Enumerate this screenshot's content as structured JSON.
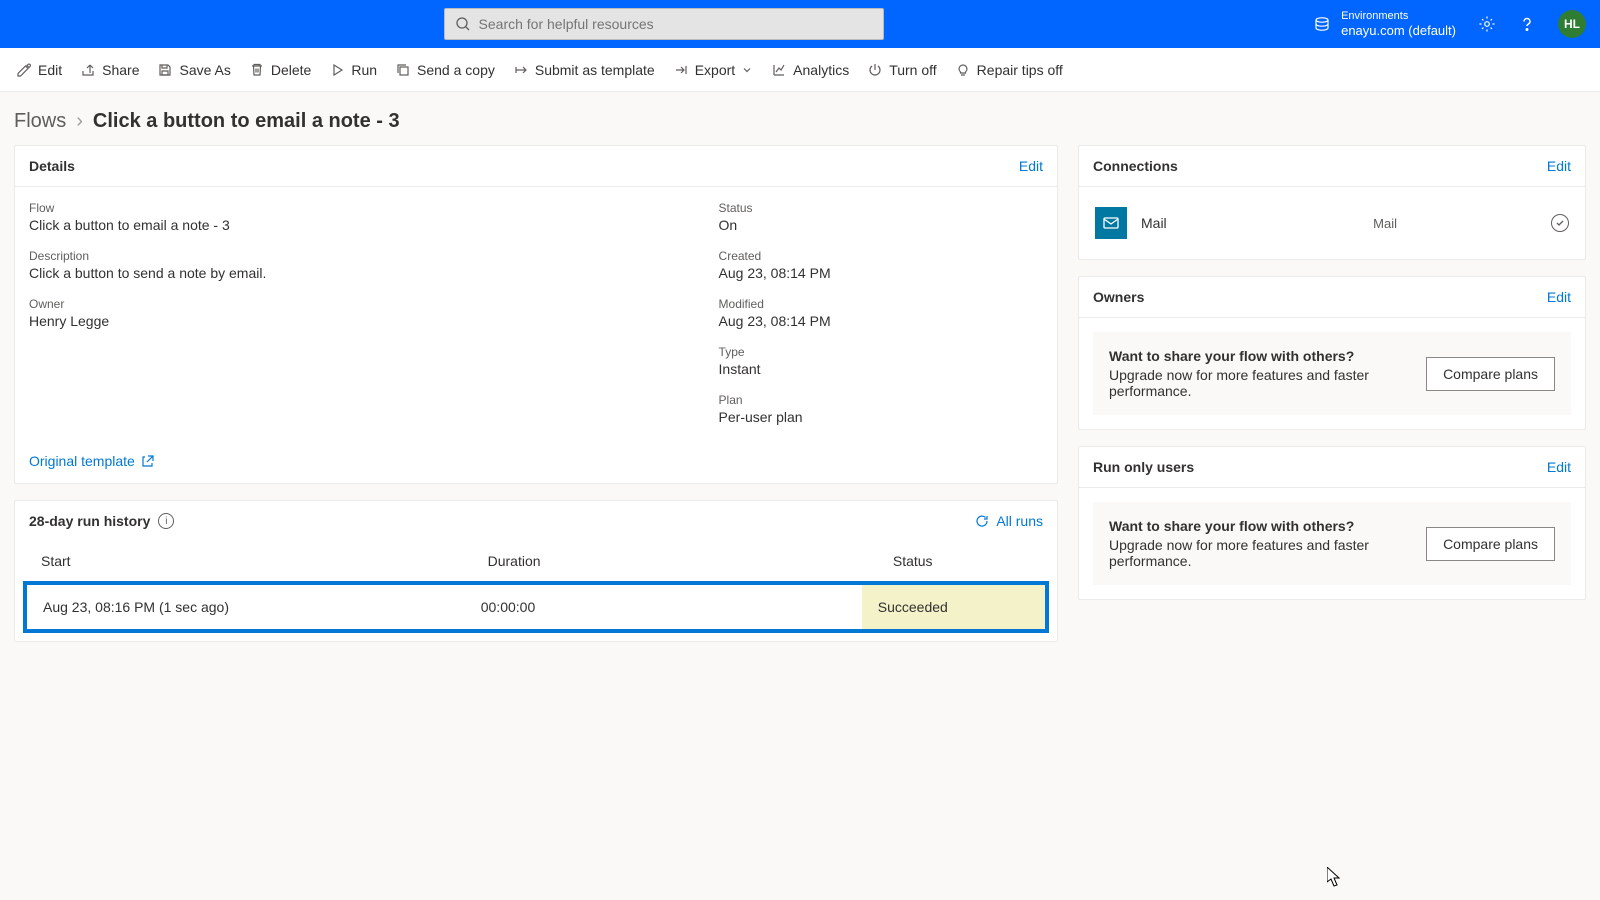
{
  "header": {
    "search_placeholder": "Search for helpful resources",
    "env_label": "Environments",
    "env_value": "enayu.com (default)",
    "avatar": "HL"
  },
  "toolbar": {
    "edit": "Edit",
    "share": "Share",
    "save_as": "Save As",
    "delete": "Delete",
    "run": "Run",
    "send_copy": "Send a copy",
    "submit_template": "Submit as template",
    "export": "Export",
    "analytics": "Analytics",
    "turn_off": "Turn off",
    "repair_tips": "Repair tips off"
  },
  "breadcrumb": {
    "root": "Flows",
    "current": "Click a button to email a note - 3"
  },
  "cards": {
    "details_title": "Details",
    "connections_title": "Connections",
    "owners_title": "Owners",
    "run_only_title": "Run only users",
    "edit": "Edit"
  },
  "details": {
    "flow_label": "Flow",
    "flow_value": "Click a button to email a note - 3",
    "desc_label": "Description",
    "desc_value": "Click a button to send a note by email.",
    "owner_label": "Owner",
    "owner_value": "Henry Legge",
    "status_label": "Status",
    "status_value": "On",
    "created_label": "Created",
    "created_value": "Aug 23, 08:14 PM",
    "modified_label": "Modified",
    "modified_value": "Aug 23, 08:14 PM",
    "type_label": "Type",
    "type_value": "Instant",
    "plan_label": "Plan",
    "plan_value": "Per-user plan",
    "original_template": "Original template"
  },
  "history": {
    "title": "28-day run history",
    "all_runs": "All runs",
    "col_start": "Start",
    "col_duration": "Duration",
    "col_status": "Status",
    "row_start": "Aug 23, 08:16 PM (1 sec ago)",
    "row_duration": "00:00:00",
    "row_status": "Succeeded"
  },
  "connections": {
    "name": "Mail",
    "type": "Mail"
  },
  "promo": {
    "title": "Want to share your flow with others?",
    "body": "Upgrade now for more features and faster performance.",
    "button": "Compare plans"
  }
}
